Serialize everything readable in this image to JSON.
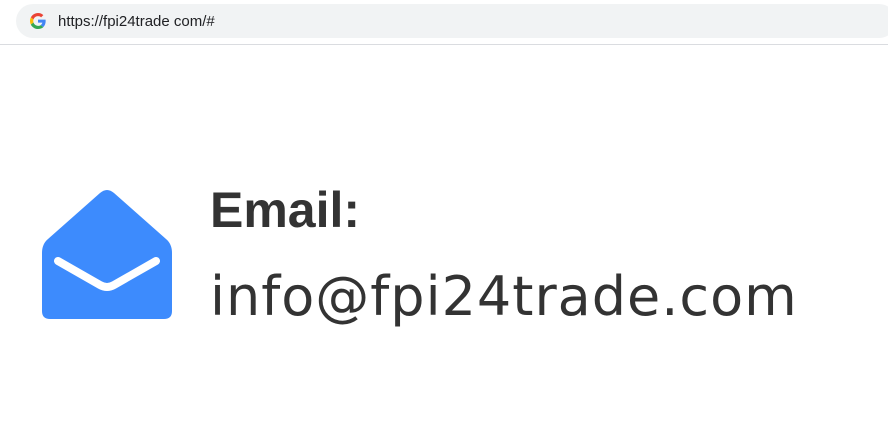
{
  "browser": {
    "url": "https://fpi24trade com/#",
    "favicon_icon": "google-g-icon"
  },
  "contact": {
    "icon": "envelope-icon",
    "heading": "Email:",
    "address": "info@fpi24trade.com",
    "icon_color": "#3d8bfd",
    "text_color": "#333333"
  }
}
